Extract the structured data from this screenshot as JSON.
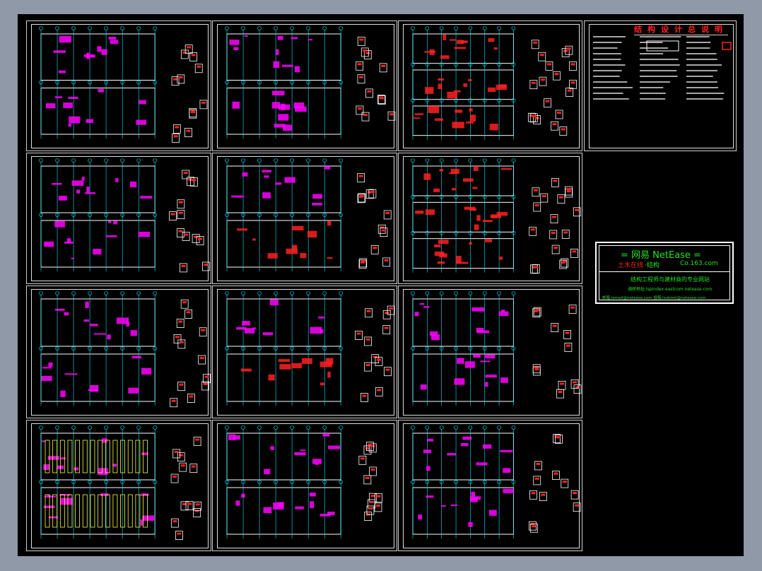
{
  "colors": {
    "background": "#8f99a8",
    "canvas": "#000000",
    "frame": "#e0e0e0",
    "cyan": "#00e5ff",
    "magenta": "#ff00ff",
    "red": "#ff2020",
    "green": "#22e022",
    "yellow": "#ffff40"
  },
  "title_block": {
    "heading": "结构设计总说明"
  },
  "netease": {
    "brand": "=  网易 NetEase  =",
    "channel": "土木在线",
    "section": "·结构",
    "domain": "Co.163.com",
    "slogan": "结构工程师与建材商的专业网站",
    "line1": "调研地址:lspindex.eastcom.netease.com",
    "line2": "邮箱:lemail@netease.com   投稿:lsubmit@netease.com"
  },
  "sheets": [
    {
      "id": "s1",
      "kind": "notes-elev"
    },
    {
      "id": "s2",
      "kind": "plan"
    },
    {
      "id": "s3",
      "kind": "beams"
    },
    {
      "id": "s4",
      "kind": "notes"
    },
    {
      "id": "s5",
      "kind": "plan"
    },
    {
      "id": "s6",
      "kind": "grid"
    },
    {
      "id": "s7",
      "kind": "beams"
    },
    {
      "id": "s8",
      "kind": "plan"
    },
    {
      "id": "s9",
      "kind": "grid"
    },
    {
      "id": "s10",
      "kind": "stairs"
    },
    {
      "id": "s11",
      "kind": "elevation"
    },
    {
      "id": "s12",
      "kind": "roof"
    },
    {
      "id": "s13",
      "kind": "stairs"
    }
  ]
}
